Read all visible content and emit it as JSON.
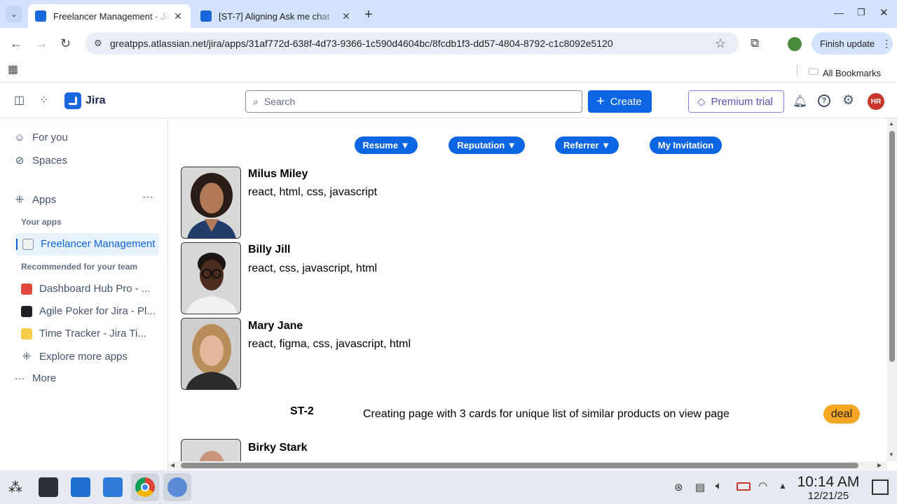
{
  "browser": {
    "tabs": [
      {
        "title": "Freelancer Management - Jira",
        "active": true
      },
      {
        "title": "[ST-7] Aligning Ask me chat",
        "active": false
      }
    ],
    "url": "greatpps.atlassian.net/jira/apps/31af772d-638f-4d73-9366-1c590d4604bc/8fcdb1f3-dd57-4804-8792-c1c8092e5120",
    "finish_update": "Finish update",
    "all_bookmarks": "All Bookmarks"
  },
  "header": {
    "app_name": "Jira",
    "search_placeholder": "Search",
    "create_label": "Create",
    "premium_label": "Premium trial",
    "avatar_initials": "HR"
  },
  "sidebar": {
    "for_you": "For you",
    "spaces": "Spaces",
    "apps": "Apps",
    "your_apps": "Your apps",
    "selected_app": "Freelancer Management",
    "recommended": "Recommended for your team",
    "recommended_apps": [
      {
        "label": "Dashboard Hub Pro - ...",
        "color": "#e2483d"
      },
      {
        "label": "Agile Poker for Jira - Pl...",
        "color": "#1d2125"
      },
      {
        "label": "Time Tracker - Jira Ti...",
        "color": "#f5cd47"
      }
    ],
    "explore": "Explore more apps",
    "more": "More"
  },
  "main": {
    "filters": [
      "Resume ▼",
      "Reputation ▼",
      "Referrer ▼",
      "My Invitation"
    ],
    "cards": [
      {
        "name": "Milus Miley",
        "skills": "react, html, css, javascript",
        "avatar": "woman-curly-hair-avatar"
      },
      {
        "name": "Billy Jill",
        "skills": "react, css, javascript, html",
        "avatar": "man-glasses-avatar"
      },
      {
        "name": "Mary Jane",
        "skills": "react, figma, css, javascript, html",
        "avatar": "woman-blonde-avatar"
      }
    ],
    "task": {
      "key": "ST-2",
      "summary": "Creating page with 3 cards for unique list of similar products on view page",
      "badge": "deal"
    },
    "next_card_name": "Birky Stark"
  },
  "taskbar": {
    "time": "10:14 AM",
    "date": "12/21/25"
  },
  "colors": {
    "primary": "#0c66e4",
    "badge": "#f5a623"
  }
}
